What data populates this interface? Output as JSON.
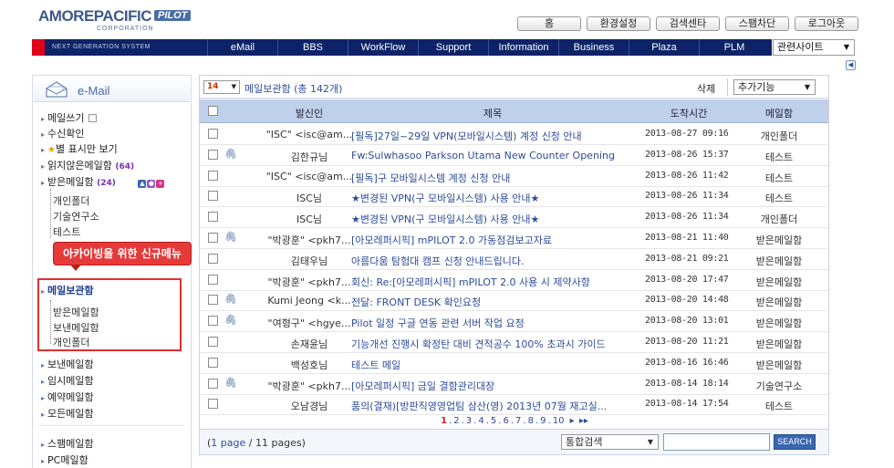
{
  "brand": {
    "name": "AMOREPACIFIC",
    "product": "PILOT",
    "sub": "CORPORATION"
  },
  "top_buttons": [
    {
      "label": "홈",
      "w": 70
    },
    {
      "label": "환경설정",
      "w": 70
    },
    {
      "label": "검색센타",
      "w": 70
    },
    {
      "label": "스팸차단",
      "w": 70
    },
    {
      "label": "로그아웃",
      "w": 70
    }
  ],
  "nav": {
    "tagline": "NEXT GENERATION SYSTEM",
    "items": [
      {
        "label": "eMail"
      },
      {
        "label": "BBS"
      },
      {
        "label": "WorkFlow"
      },
      {
        "label": "Support"
      },
      {
        "label": "Information"
      },
      {
        "label": "Business"
      },
      {
        "label": "Plaza"
      },
      {
        "label": "PLM"
      }
    ],
    "related_site": "관련사이트"
  },
  "sidebar": {
    "title": "e-Mail",
    "menu": {
      "compose": "메일쓰기",
      "check": "수신확인",
      "starred": "별 표시만 보기",
      "unread": "읽지않은메일함",
      "unread_count": "(64)",
      "inbox": "받은메일함",
      "inbox_count": "(24)",
      "inbox_sub": [
        "개인폴더",
        "기술연구소",
        "테스트"
      ],
      "archive": "메일보관함",
      "archive_sub": [
        "받은메일함",
        "보낸메일함",
        "개인폴더"
      ],
      "sent": "보낸메일함",
      "drafts": "임시메일함",
      "scheduled": "예약메일함",
      "all": "모든메일함",
      "spam": "스팸메일함",
      "pc": "PC메일함"
    },
    "callout": "아카이빙을 위한 신규메뉴"
  },
  "toolbar": {
    "per_page": "14",
    "folder": "메일보관함",
    "total": "(총 142개)",
    "delete": "삭제",
    "add_function": "추가기능"
  },
  "table": {
    "headers": {
      "sender": "발신인",
      "subject": "제목",
      "arrived": "도착시간",
      "mailbox": "메일함"
    },
    "rows": [
      {
        "clip": false,
        "sender": "\"ISC\" <isc@am...",
        "subject": "[필독]27일~29일 VPN(모바일시스템) 계정 신청 안내",
        "date": "2013-08-27 09:16",
        "box": "개인폴더"
      },
      {
        "clip": true,
        "sender": "김한규님",
        "subject": "Fw:Sulwhasoo Parkson Utama New Counter Opening",
        "date": "2013-08-26 15:37",
        "box": "테스트"
      },
      {
        "clip": false,
        "sender": "\"ISC\" <isc@am...",
        "subject": "[필독]구 모바일시스템 계정 신청 안내",
        "date": "2013-08-26 11:42",
        "box": "테스트"
      },
      {
        "clip": false,
        "sender": "ISC님",
        "subject": "★변경된 VPN(구 모바일시스템) 사용 안내★",
        "date": "2013-08-26 11:34",
        "box": "테스트"
      },
      {
        "clip": false,
        "sender": "ISC님",
        "subject": "★변경된 VPN(구 모바일시스템) 사용 안내★",
        "date": "2013-08-26 11:34",
        "box": "개인폴더"
      },
      {
        "clip": true,
        "sender": "\"박광훈\" <pkh7...",
        "subject": "[아모레퍼시픽] mPILOT 2.0 가동점검보고자료",
        "date": "2013-08-21 11:40",
        "box": "받은메일함"
      },
      {
        "clip": false,
        "sender": "김태우님",
        "subject": "아름다움 탐험대 캠프 신청 안내드립니다.",
        "date": "2013-08-21 09:21",
        "box": "받은메일함"
      },
      {
        "clip": false,
        "sender": "\"박광훈\" <pkh7...",
        "subject": "회신: Re:[아모레퍼시픽] mPILOT 2.0 사용 시 제약사항",
        "date": "2013-08-20 17:47",
        "box": "받은메일함"
      },
      {
        "clip": true,
        "sender": "Kumi Jeong <k...",
        "subject": "전달: FRONT DESK 확인요청",
        "date": "2013-08-20 14:48",
        "box": "받은메일함"
      },
      {
        "clip": true,
        "sender": "\"여형구\" <hgye...",
        "subject": "Pilot 일정 구글 연동 관련 서버 작업 요청",
        "date": "2013-08-20 13:01",
        "box": "받은메일함"
      },
      {
        "clip": false,
        "sender": "손재윤님",
        "subject": "기능개선 진행시 확정탄 대비 견적공수 100% 초과시 가이드",
        "date": "2013-08-20 11:21",
        "box": "받은메일함"
      },
      {
        "clip": false,
        "sender": "백성호님",
        "subject": "테스트 메일",
        "date": "2013-08-16 16:46",
        "box": "받은메일함"
      },
      {
        "clip": true,
        "sender": "\"박광훈\" <pkh7...",
        "subject": "[아모레퍼시픽] 금일 결함관리대장",
        "date": "2013-08-14 18:14",
        "box": "기술연구소"
      },
      {
        "clip": false,
        "sender": "오남경님",
        "subject": "품의(결재)[방판직영영업팀 삼산(영) 2013년 07월 재고실...",
        "date": "2013-08-14 17:54",
        "box": "테스트"
      }
    ]
  },
  "pager": {
    "pages": [
      "1",
      "2",
      "3",
      "4",
      "5",
      "6",
      "7",
      "8",
      "9",
      "10"
    ],
    "current": "1"
  },
  "footer": {
    "page_prefix": "(",
    "page_num": "1 page",
    "page_suffix": " / 11 pages)",
    "search_type": "통합검색",
    "search_value": "",
    "search_button": "SEARCH"
  }
}
